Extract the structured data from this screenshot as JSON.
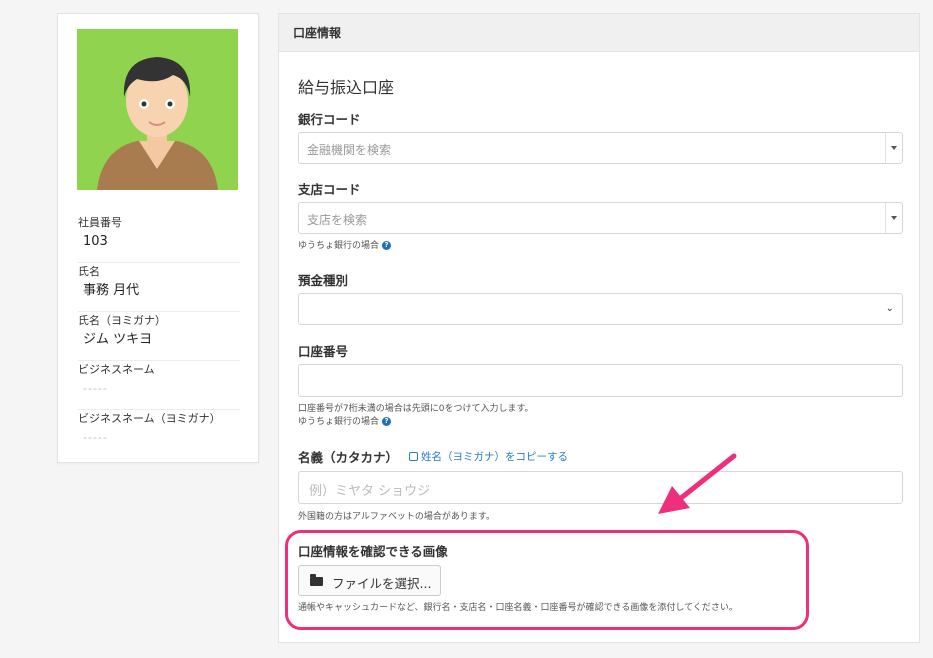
{
  "employee": {
    "fields": [
      {
        "label": "社員番号",
        "value": "103",
        "muted": false
      },
      {
        "label": "氏名",
        "value": "事務 月代",
        "muted": false
      },
      {
        "label": "氏名（ヨミガナ）",
        "value": "ジム ツキヨ",
        "muted": false
      },
      {
        "label": "ビジネスネーム",
        "value": "-----",
        "muted": true
      },
      {
        "label": "ビジネスネーム（ヨミガナ）",
        "value": "-----",
        "muted": true
      }
    ]
  },
  "panel": {
    "header": "口座情報",
    "section_title": "給与振込口座",
    "bank_code": {
      "label": "銀行コード",
      "placeholder": "金融機関を検索"
    },
    "branch_code": {
      "label": "支店コード",
      "placeholder": "支店を検索",
      "help": "ゆうちょ銀行の場合"
    },
    "deposit_type": {
      "label": "預金種別",
      "value": ""
    },
    "account_number": {
      "label": "口座番号",
      "value": "",
      "help_1": "口座番号が7桁未満の場合は先頭に0をつけて入力します。",
      "help_2": "ゆうちょ銀行の場合"
    },
    "account_name": {
      "label": "名義（カタカナ）",
      "copy_link": "姓名（ヨミガナ）をコピーする",
      "placeholder": "例）ミヤタ ショウジ",
      "help": "外国籍の方はアルファベットの場合があります。"
    },
    "image_upload": {
      "label": "口座情報を確認できる画像",
      "button": "ファイルを選択...",
      "help": "通帳やキャッシュカードなど、銀行名・支店名・口座名義・口座番号が確認できる画像を添付してください。"
    }
  },
  "colors": {
    "highlight": "#ee2f7c",
    "link": "#2a7ad1",
    "avatar_bg": "#8fd34e"
  }
}
